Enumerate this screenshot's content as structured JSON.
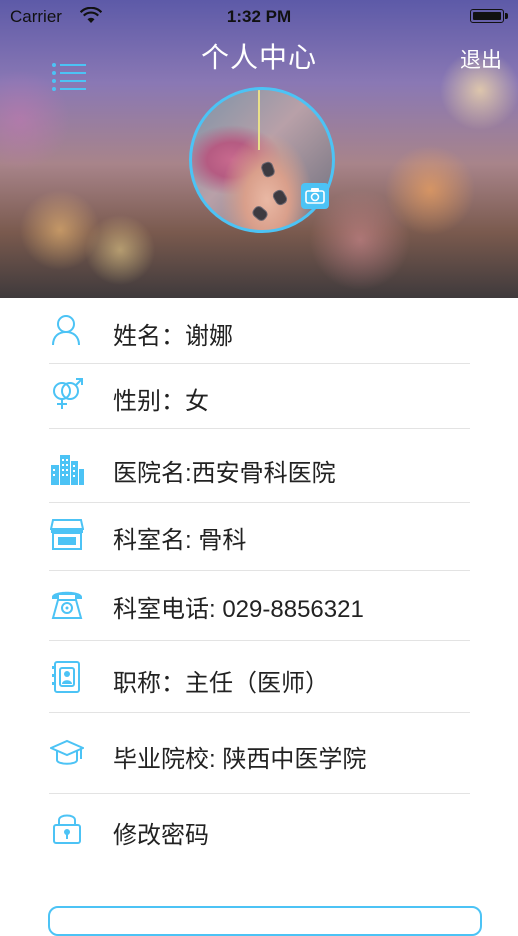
{
  "status_bar": {
    "carrier": "Carrier",
    "time": "1:32 PM"
  },
  "header": {
    "title": "个人中心",
    "logout_label": "退出",
    "menu_icon": "menu-list-icon",
    "camera_icon": "camera-icon"
  },
  "profile": {
    "name_text": "姓名：谢娜",
    "gender_text": "性别：女",
    "hospital_text": "医院名:西安骨科医院",
    "department_text": "科室名: 骨科",
    "dept_phone_text": "科室电话: 029-8856321",
    "title_text": "职称：主任（医师）",
    "school_text": "毕业院校: 陕西中医学院",
    "change_password_text": "修改密码"
  },
  "colors": {
    "accent": "#4cc3f5",
    "divider": "#e3e3e3",
    "text": "#222222"
  }
}
